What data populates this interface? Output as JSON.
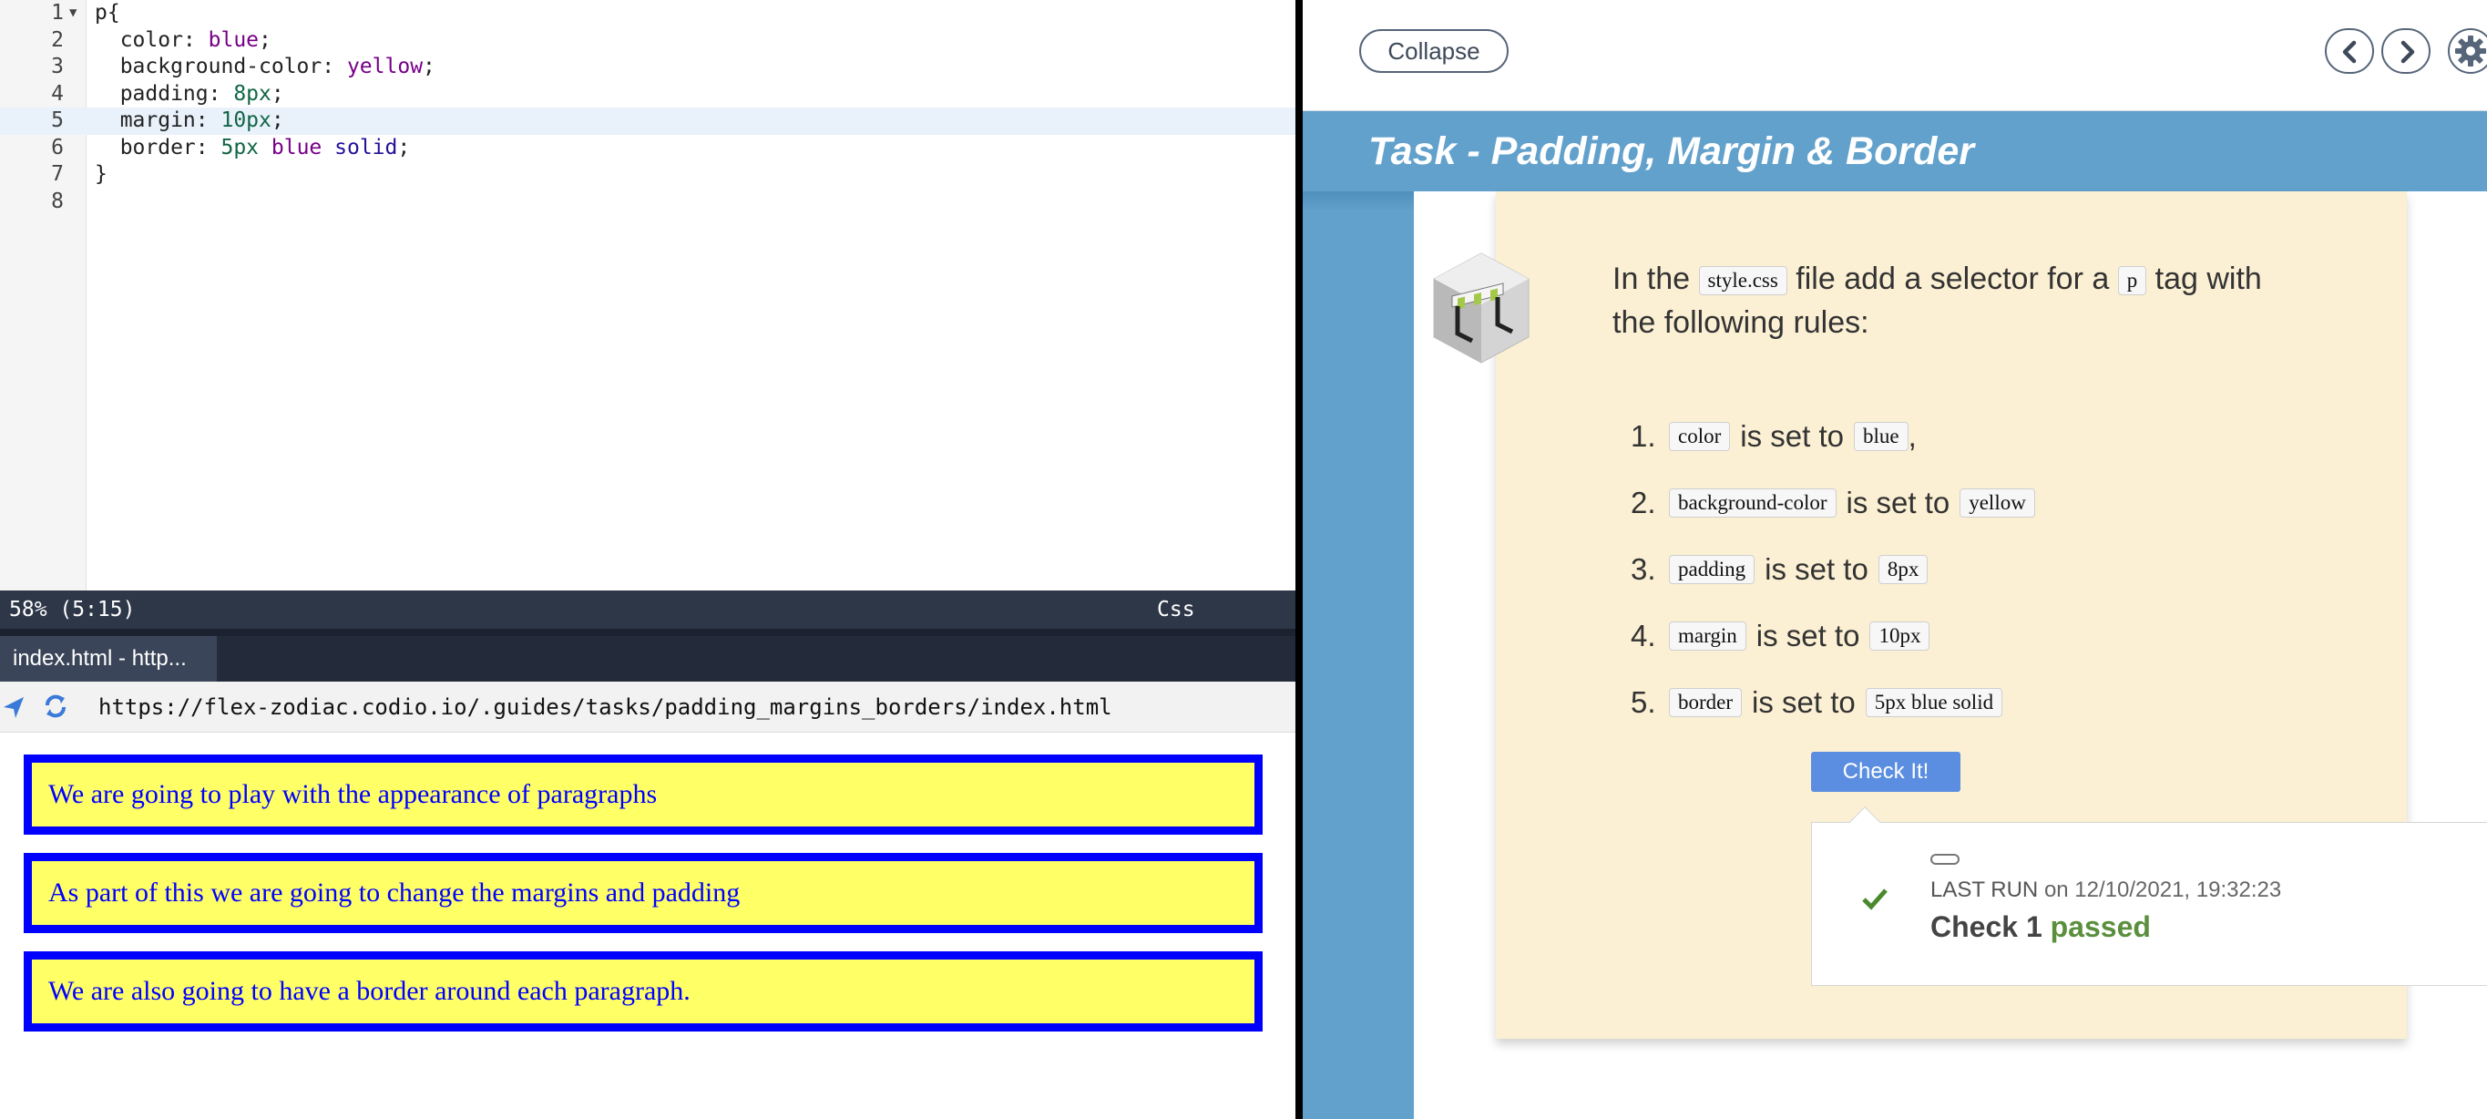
{
  "editor": {
    "lines": [
      {
        "num": "1",
        "fold": "▼",
        "tokens": [
          [
            "p{",
            "t-prop"
          ]
        ]
      },
      {
        "num": "2",
        "tokens": [
          [
            "  color: ",
            "t-prop"
          ],
          [
            "blue",
            "t-kw"
          ],
          [
            ";",
            "t-prop"
          ]
        ]
      },
      {
        "num": "3",
        "tokens": [
          [
            "  background-color: ",
            "t-prop"
          ],
          [
            "yellow",
            "t-kw"
          ],
          [
            ";",
            "t-prop"
          ]
        ]
      },
      {
        "num": "4",
        "tokens": [
          [
            "  padding: ",
            "t-prop"
          ],
          [
            "8px",
            "t-num"
          ],
          [
            ";",
            "t-prop"
          ]
        ]
      },
      {
        "num": "5",
        "active": true,
        "tokens": [
          [
            "  margin: ",
            "t-prop"
          ],
          [
            "10px",
            "t-num"
          ],
          [
            ";",
            "t-prop"
          ]
        ]
      },
      {
        "num": "6",
        "tokens": [
          [
            "  border: ",
            "t-prop"
          ],
          [
            "5px",
            "t-num"
          ],
          [
            " ",
            "t-prop"
          ],
          [
            "blue",
            "t-kw"
          ],
          [
            " ",
            "t-prop"
          ],
          [
            "solid",
            "t-val"
          ],
          [
            ";",
            "t-prop"
          ]
        ]
      },
      {
        "num": "7",
        "tokens": [
          [
            "}",
            "t-prop"
          ]
        ]
      },
      {
        "num": "8",
        "tokens": []
      }
    ],
    "status_position": "58%  (5:15)",
    "status_mode": "Css"
  },
  "preview": {
    "tab_label": "index.html - http...",
    "url": "https://flex-zodiac.codio.io/.guides/tasks/padding_margins_borders/index.html",
    "paragraphs": [
      "We are going to play with the appearance of paragraphs",
      "As part of this we are going to change the margins and padding",
      "We are also going to have a border around each paragraph."
    ]
  },
  "guide": {
    "collapse_label": "Collapse",
    "title": "Task - Padding, Margin & Border",
    "intro_before": "In the",
    "intro_file": "style.css",
    "intro_mid": "file add a selector for a",
    "intro_tag": "p",
    "intro_after": "tag with the following rules:",
    "rules": [
      {
        "num": "1.",
        "prop": "color",
        "text": "is set to",
        "value": "blue",
        "suffix": ","
      },
      {
        "num": "2.",
        "prop": "background-color",
        "text": "is set to",
        "value": "yellow",
        "suffix": ""
      },
      {
        "num": "3.",
        "prop": "padding",
        "text": "is set to",
        "value": "8px",
        "suffix": ""
      },
      {
        "num": "4.",
        "prop": "margin",
        "text": "is set to",
        "value": "10px",
        "suffix": ""
      },
      {
        "num": "5.",
        "prop": "border",
        "text": "is set to",
        "value": "5px blue solid",
        "suffix": ""
      }
    ],
    "check_button": "Check It!",
    "result": {
      "run_label": "LAST RUN",
      "run_on": "on 12/10/2021, 19:32:23",
      "check_name": "Check 1",
      "check_status": "passed"
    }
  },
  "colors": {
    "accent_blue": "#62a1cc",
    "card_bg": "#fcf0d4",
    "button_blue": "#5b8ee0",
    "pass_green": "#5a8f3d",
    "para_border": "#0000ff",
    "para_bg": "#ffff66"
  }
}
